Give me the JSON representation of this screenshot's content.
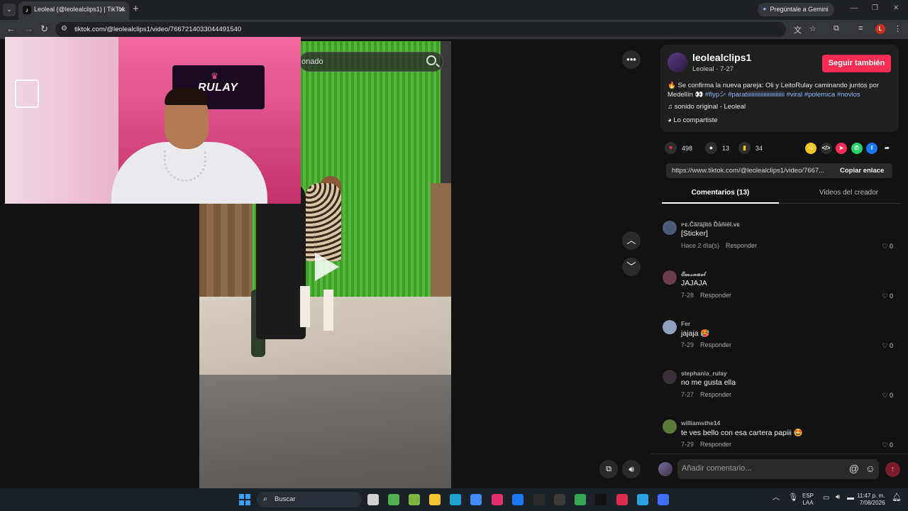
{
  "browser": {
    "tab_title": "Leoleal (@leolealclips1) | TikTok",
    "tab_favicon": "tiktok-icon",
    "gemini_label": "Pregúntale a Gemini",
    "url": "tiktok.com/@leolealclips1/video/7667214033044491540",
    "profile_initial": "L"
  },
  "video": {
    "search_text": "onado",
    "webcam_logo": "RULAY"
  },
  "creator": {
    "username": "leolealclips1",
    "subline": "Leoleal · 7-27",
    "follow_label": "Seguir también",
    "description_text": "🔥 Se confirma la nueva pareja: Oli y LeitoRulay caminando juntos por Medellín 👀",
    "description_tags": "#flypシ #paratiiiiiiiiiiiiiiiiiiiiiiiii #viral #polemica #novios",
    "sound": "sonido original - Leoleal",
    "shared": "Lo compartiste"
  },
  "stats": {
    "likes": "498",
    "comments": "13",
    "saves": "34"
  },
  "share_icons": [
    {
      "name": "friends-share-icon",
      "color": "#f3c623",
      "glyph": "☺"
    },
    {
      "name": "embed-icon",
      "color": "#2e2e2e",
      "glyph": "</>"
    },
    {
      "name": "send-icon",
      "color": "#fe2c55",
      "glyph": "➤"
    },
    {
      "name": "whatsapp-icon",
      "color": "#25d366",
      "glyph": "✆"
    },
    {
      "name": "facebook-icon",
      "color": "#1877f2",
      "glyph": "f"
    },
    {
      "name": "share-arrow-icon",
      "color": "#121212",
      "glyph": "➦"
    }
  ],
  "link": {
    "url": "https://www.tiktok.com/@leolealclips1/video/7667...",
    "copy_label": "Copiar enlace"
  },
  "tabs": {
    "comments": "Comentarios (13)",
    "videos": "Videos del creador"
  },
  "comments": [
    {
      "user": "ᴘᴇ.Čãřäjîtô Ďåñîêl.ᴠᴇ",
      "text": "[Sticker]",
      "date": "Hace 2 día(s)",
      "reply": "Responder",
      "likes": "0",
      "color": "#4d5b7a"
    },
    {
      "user": "𝓔𝓶𝔁𝓷𝓾𝓮𝓵",
      "text": "JAJAJA",
      "date": "7-28",
      "reply": "Responder",
      "likes": "0",
      "color": "#6b3b4a"
    },
    {
      "user": "Fer",
      "text": "jajaja 🥵",
      "date": "7-29",
      "reply": "Responder",
      "likes": "0",
      "color": "#8ea0c0"
    },
    {
      "user": "stephania_rulay",
      "text": "no me gusta ella",
      "date": "7-27",
      "reply": "Responder",
      "likes": "0",
      "color": "#3a2f38"
    },
    {
      "user": "williamsthe14",
      "text": "te ves bello con esa cartera papiii 🤩",
      "date": "7-29",
      "reply": "Responder",
      "likes": "0",
      "color": "#5b7a3b"
    }
  ],
  "comment_bar": {
    "placeholder": "Añadir comentario..."
  },
  "taskbar": {
    "search_label": "Buscar",
    "lang_top": "ESP",
    "lang_bottom": "LAA",
    "time": "11:47 p. m.",
    "date": "7/08/2026",
    "apps": [
      {
        "name": "task-view-icon",
        "color": "#d0d0d0"
      },
      {
        "name": "widgets-icon",
        "color": "#4caf50"
      },
      {
        "name": "app-icon",
        "color": "#7cb342"
      },
      {
        "name": "file-explorer-icon",
        "color": "#f4c430"
      },
      {
        "name": "edge-icon",
        "color": "#1fa3d5"
      },
      {
        "name": "store-icon",
        "color": "#3d8bfd"
      },
      {
        "name": "instagram-icon",
        "color": "#e1306c"
      },
      {
        "name": "facebook-taskbar-icon",
        "color": "#1877f2"
      },
      {
        "name": "red-app-icon",
        "color": "#2b2b2b"
      },
      {
        "name": "obs-icon",
        "color": "#3b3b3b"
      },
      {
        "name": "chrome-icon",
        "color": "#34a853"
      },
      {
        "name": "tiktok-taskbar-icon",
        "color": "#111111"
      },
      {
        "name": "tiktok-live-icon",
        "color": "#d92b4f"
      },
      {
        "name": "telegram-icon",
        "color": "#2aa3e0"
      },
      {
        "name": "blue-app-icon",
        "color": "#3f6df5"
      }
    ]
  }
}
